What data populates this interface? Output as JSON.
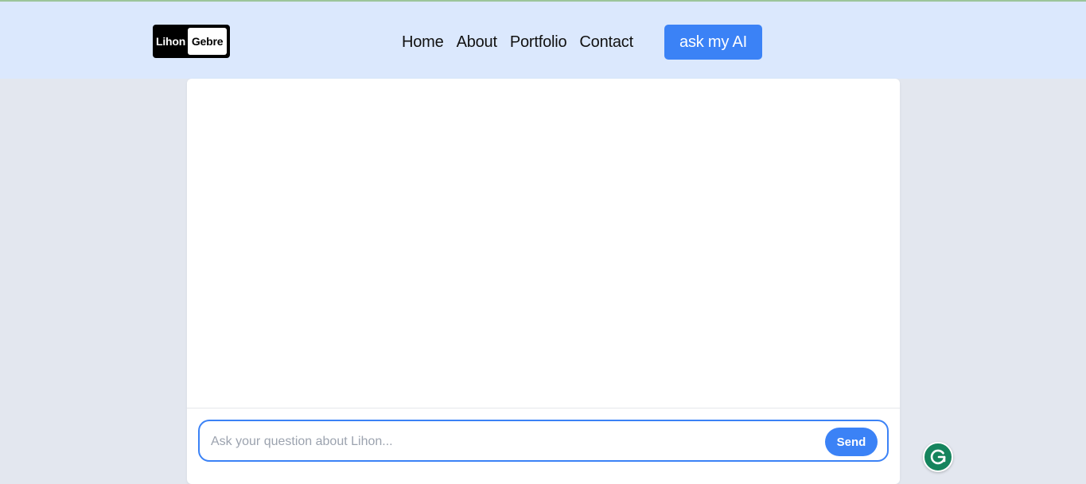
{
  "logo": {
    "left_text": "Lihon",
    "right_text": "Gebre"
  },
  "nav": {
    "links": [
      {
        "label": "Home"
      },
      {
        "label": "About"
      },
      {
        "label": "Portfolio"
      },
      {
        "label": "Contact"
      }
    ],
    "ai_button_label": "ask my AI"
  },
  "chat": {
    "input_placeholder": "Ask your question about Lihon...",
    "input_value": "",
    "send_label": "Send"
  },
  "colors": {
    "navbar_bg": "#dbe8fd",
    "page_bg": "#e3e7ef",
    "accent": "#3b82f6",
    "grammarly": "#15845d"
  },
  "icons": {
    "grammarly": "grammarly-icon"
  }
}
